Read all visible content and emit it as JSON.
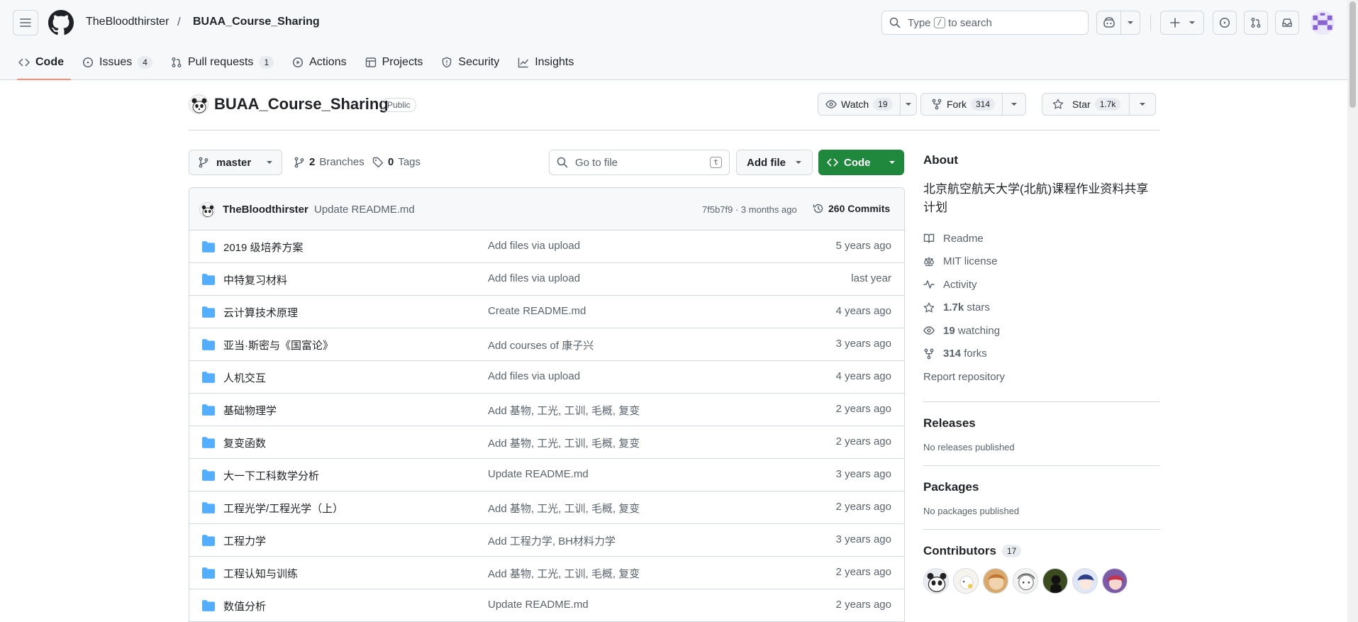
{
  "header": {
    "owner": "TheBloodthirster",
    "separator": "/",
    "repo": "BUAA_Course_Sharing",
    "search_prefix": "Type",
    "search_key": "/",
    "search_suffix": "to search"
  },
  "tabs": [
    {
      "label": "Code",
      "icon": "code-icon",
      "active": true
    },
    {
      "label": "Issues",
      "icon": "issue-opened-icon",
      "count": "4"
    },
    {
      "label": "Pull requests",
      "icon": "git-pull-request-icon",
      "count": "1"
    },
    {
      "label": "Actions",
      "icon": "play-icon"
    },
    {
      "label": "Projects",
      "icon": "table-icon"
    },
    {
      "label": "Security",
      "icon": "shield-icon"
    },
    {
      "label": "Insights",
      "icon": "graph-icon"
    }
  ],
  "repo": {
    "name": "BUAA_Course_Sharing",
    "visibility": "Public",
    "watch_label": "Watch",
    "watch_count": "19",
    "fork_label": "Fork",
    "fork_count": "314",
    "star_label": "Star",
    "star_count": "1.7k"
  },
  "filenav": {
    "branch": "master",
    "branches_count": "2",
    "branches_label": "Branches",
    "tags_count": "0",
    "tags_label": "Tags",
    "goto_placeholder": "Go to file",
    "goto_key": "t",
    "add_file": "Add file",
    "code_button": "Code"
  },
  "commit": {
    "author": "TheBloodthirster",
    "message": "Update README.md",
    "hash_time": "7f5b7f9 · 3 months ago",
    "count_label": "260 Commits"
  },
  "files": [
    {
      "name": "2019 级培养方案",
      "message": "Add files via upload",
      "age": "5 years ago"
    },
    {
      "name": "中特复习材料",
      "message": "Add files via upload",
      "age": "last year"
    },
    {
      "name": "云计算技术原理",
      "message": "Create README.md",
      "age": "4 years ago"
    },
    {
      "name": "亚当·斯密与《国富论》",
      "message": "Add courses of 康子兴",
      "age": "3 years ago"
    },
    {
      "name": "人机交互",
      "message": "Add files via upload",
      "age": "4 years ago"
    },
    {
      "name": "基础物理学",
      "message": "Add 基物, 工光, 工训, 毛概, 复变",
      "age": "2 years ago"
    },
    {
      "name": "复变函数",
      "message": "Add 基物, 工光, 工训, 毛概, 复变",
      "age": "2 years ago"
    },
    {
      "name": "大一下工科数学分析",
      "message": "Update README.md",
      "age": "3 years ago"
    },
    {
      "name": "工程光学/工程光学（上）",
      "message": "Add 基物, 工光, 工训, 毛概, 复变",
      "age": "2 years ago"
    },
    {
      "name": "工程力学",
      "message": "Add 工程力学, BH材料力学",
      "age": "3 years ago"
    },
    {
      "name": "工程认知与训练",
      "message": "Add 基物, 工光, 工训, 毛概, 复变",
      "age": "2 years ago"
    },
    {
      "name": "数值分析",
      "message": "Update README.md",
      "age": "2 years ago"
    }
  ],
  "sidebar": {
    "about_title": "About",
    "description": "北京航空航天大学(北航)课程作业资料共享计划",
    "readme": "Readme",
    "license": "MIT license",
    "activity": "Activity",
    "stars_count": "1.7k",
    "stars_label": "stars",
    "watching_count": "19",
    "watching_label": "watching",
    "forks_count": "314",
    "forks_label": "forks",
    "report": "Report repository",
    "releases_title": "Releases",
    "releases_none": "No releases published",
    "packages_title": "Packages",
    "packages_none": "No packages published",
    "contributors_title": "Contributors",
    "contributors_count": "17"
  },
  "colors": {
    "accent_green": "#1f883d",
    "folder_blue": "#54aeff",
    "tab_underline": "#fd8c73"
  }
}
